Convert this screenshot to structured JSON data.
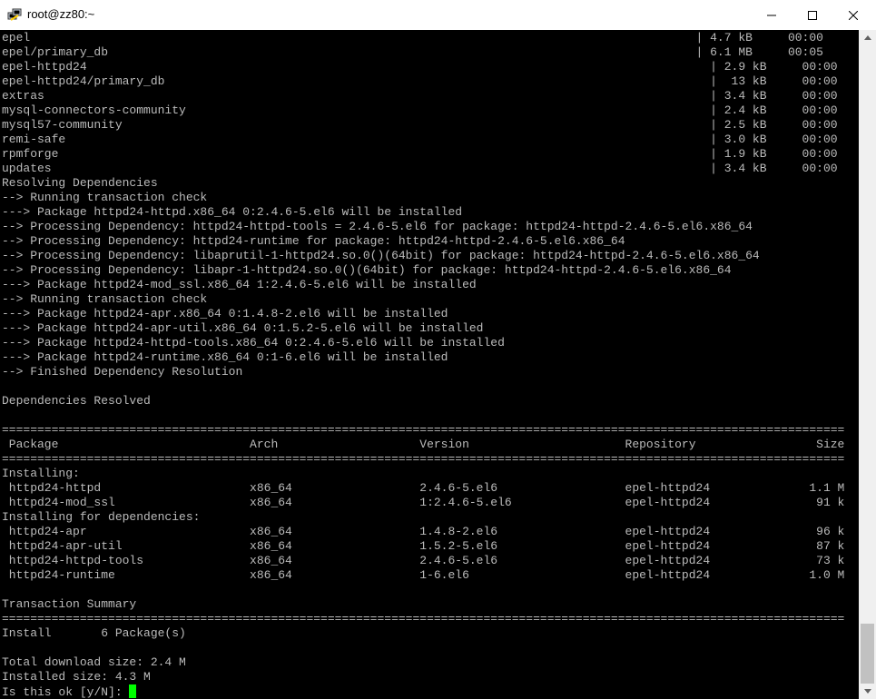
{
  "window": {
    "title": "root@zz80:~"
  },
  "terminal": {
    "lines": [
      "epel                                                                                              | 4.7 kB     00:00",
      "epel/primary_db                                                                                   | 6.1 MB     00:05",
      "epel-httpd24                                                                                        | 2.9 kB     00:00",
      "epel-httpd24/primary_db                                                                             |  13 kB     00:00",
      "extras                                                                                              | 3.4 kB     00:00",
      "mysql-connectors-community                                                                          | 2.4 kB     00:00",
      "mysql57-community                                                                                   | 2.5 kB     00:00",
      "remi-safe                                                                                           | 3.0 kB     00:00",
      "rpmforge                                                                                            | 1.9 kB     00:00",
      "updates                                                                                             | 3.4 kB     00:00",
      "Resolving Dependencies",
      "--> Running transaction check",
      "---> Package httpd24-httpd.x86_64 0:2.4.6-5.el6 will be installed",
      "--> Processing Dependency: httpd24-httpd-tools = 2.4.6-5.el6 for package: httpd24-httpd-2.4.6-5.el6.x86_64",
      "--> Processing Dependency: httpd24-runtime for package: httpd24-httpd-2.4.6-5.el6.x86_64",
      "--> Processing Dependency: libaprutil-1-httpd24.so.0()(64bit) for package: httpd24-httpd-2.4.6-5.el6.x86_64",
      "--> Processing Dependency: libapr-1-httpd24.so.0()(64bit) for package: httpd24-httpd-2.4.6-5.el6.x86_64",
      "---> Package httpd24-mod_ssl.x86_64 1:2.4.6-5.el6 will be installed",
      "--> Running transaction check",
      "---> Package httpd24-apr.x86_64 0:1.4.8-2.el6 will be installed",
      "---> Package httpd24-apr-util.x86_64 0:1.5.2-5.el6 will be installed",
      "---> Package httpd24-httpd-tools.x86_64 0:2.4.6-5.el6 will be installed",
      "---> Package httpd24-runtime.x86_64 0:1-6.el6 will be installed",
      "--> Finished Dependency Resolution",
      "",
      "Dependencies Resolved",
      "",
      "=======================================================================================================================",
      " Package                           Arch                    Version                      Repository                 Size",
      "=======================================================================================================================",
      "Installing:",
      " httpd24-httpd                     x86_64                  2.4.6-5.el6                  epel-httpd24              1.1 M",
      " httpd24-mod_ssl                   x86_64                  1:2.4.6-5.el6                epel-httpd24               91 k",
      "Installing for dependencies:",
      " httpd24-apr                       x86_64                  1.4.8-2.el6                  epel-httpd24               96 k",
      " httpd24-apr-util                  x86_64                  1.5.2-5.el6                  epel-httpd24               87 k",
      " httpd24-httpd-tools               x86_64                  2.4.6-5.el6                  epel-httpd24               73 k",
      " httpd24-runtime                   x86_64                  1-6.el6                      epel-httpd24              1.0 M",
      "",
      "Transaction Summary",
      "=======================================================================================================================",
      "Install       6 Package(s)",
      "",
      "Total download size: 2.4 M",
      "Installed size: 4.3 M",
      "Is this ok [y/N]: "
    ]
  }
}
